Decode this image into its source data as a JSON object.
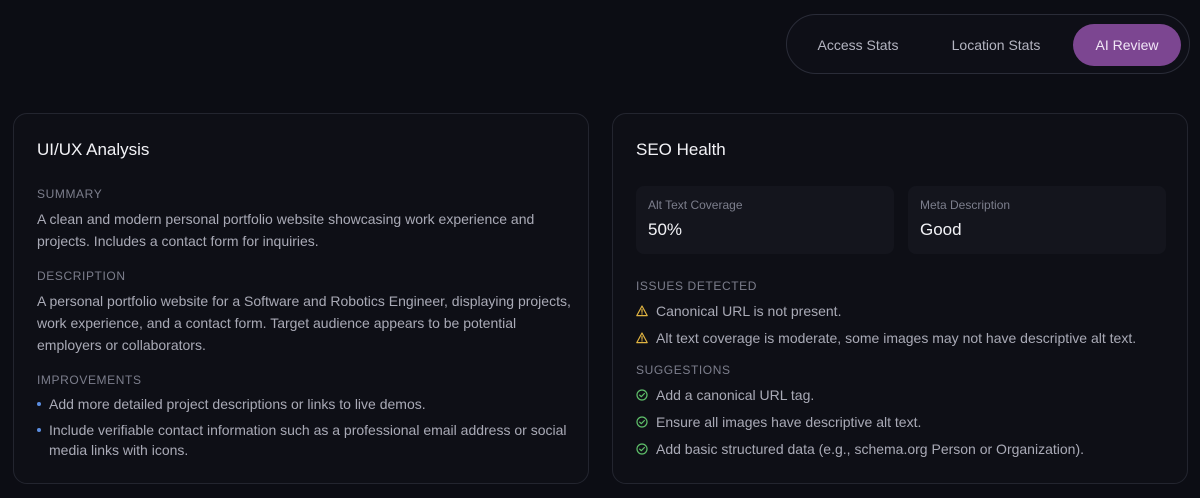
{
  "tabs": [
    {
      "label": "Access Stats",
      "active": false
    },
    {
      "label": "Location Stats",
      "active": false
    },
    {
      "label": "AI Review",
      "active": true
    }
  ],
  "colors": {
    "background": "#0c0d14",
    "active_tab": "#7c4691",
    "bullet": "#5b8de0",
    "warning": "#e0b341",
    "success": "#5fbf6a"
  },
  "uiux": {
    "title": "UI/UX Analysis",
    "summary_label": "SUMMARY",
    "summary_text": "A clean and modern personal portfolio website showcasing work experience and projects. Includes a contact form for inquiries.",
    "description_label": "DESCRIPTION",
    "description_text": "A personal portfolio website for a Software and Robotics Engineer, displaying projects, work experience, and a contact form. Target audience appears to be potential employers or collaborators.",
    "improvements_label": "IMPROVEMENTS",
    "improvements": [
      "Add more detailed project descriptions or links to live demos.",
      "Include verifiable contact information such as a professional email address or social media links with icons."
    ]
  },
  "seo": {
    "title": "SEO Health",
    "metrics": [
      {
        "label": "Alt Text Coverage",
        "value": "50%"
      },
      {
        "label": "Meta Description",
        "value": "Good"
      }
    ],
    "issues_label": "ISSUES DETECTED",
    "issues": [
      "Canonical URL is not present.",
      "Alt text coverage is moderate, some images may not have descriptive alt text."
    ],
    "suggestions_label": "SUGGESTIONS",
    "suggestions": [
      "Add a canonical URL tag.",
      "Ensure all images have descriptive alt text.",
      "Add basic structured data (e.g., schema.org Person or Organization)."
    ]
  }
}
